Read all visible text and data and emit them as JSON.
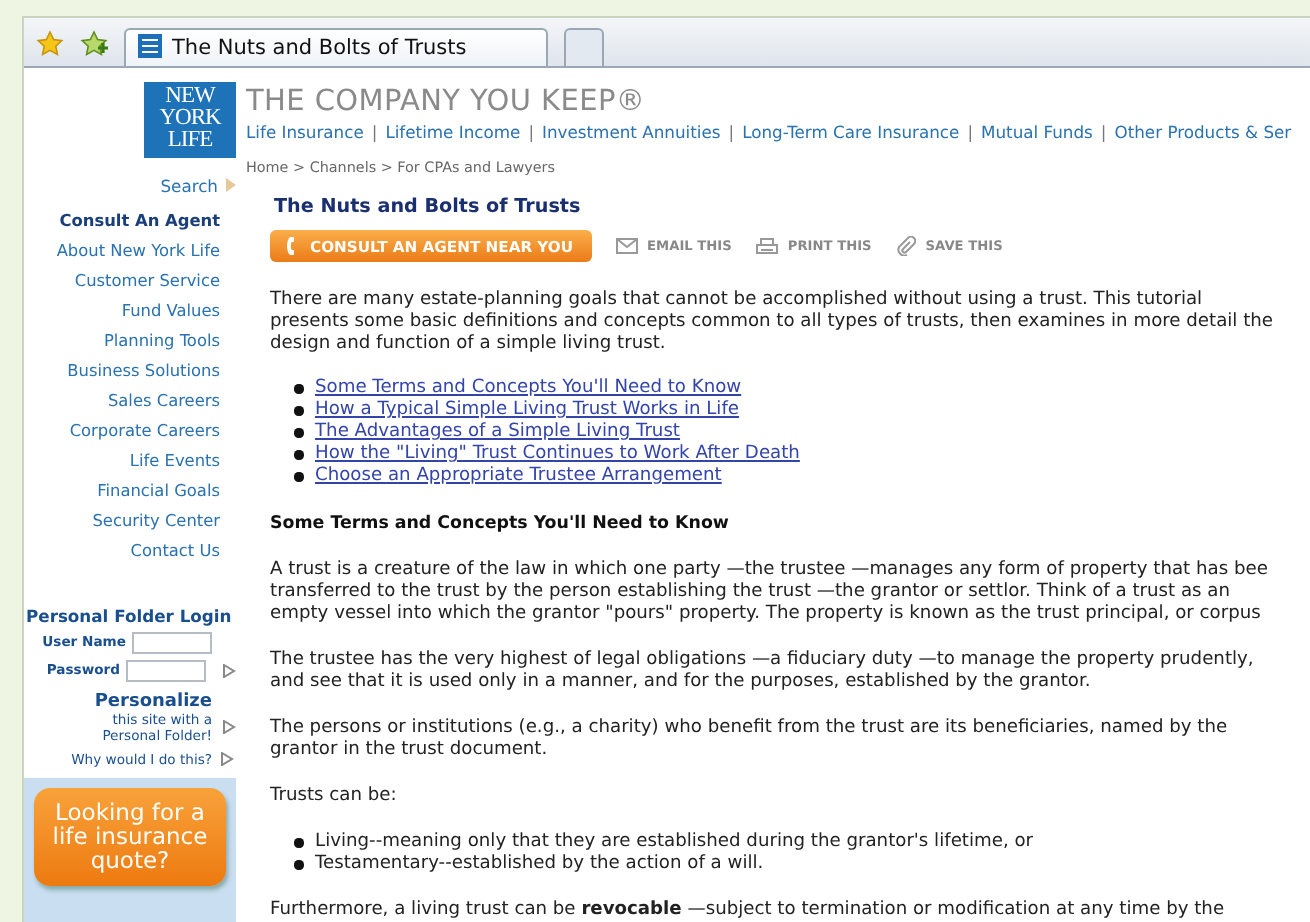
{
  "browser": {
    "tabs": [
      {
        "label": "The Nuts and Bolts of Trusts",
        "selected": true
      },
      {
        "selected": false
      }
    ]
  },
  "header": {
    "logo": [
      "NEW",
      "YORK",
      "LIFE"
    ],
    "tagline": "THE COMPANY YOU KEEP®",
    "nav_separator": "|",
    "nav": [
      "Life Insurance",
      "Lifetime Income",
      "Investment Annuities",
      "Long-Term Care Insurance",
      "Mutual Funds",
      "Other Products & Ser"
    ],
    "breadcrumb": "Home > Channels > For CPAs and Lawyers"
  },
  "sidebar": {
    "search": "Search",
    "items": [
      {
        "label": "Consult An Agent",
        "kind": "primary"
      },
      {
        "label": "About New York Life",
        "kind": "link"
      },
      {
        "label": "Customer Service",
        "kind": "link"
      },
      {
        "label": "Fund Values",
        "kind": "link"
      },
      {
        "label": "Planning Tools",
        "kind": "link"
      },
      {
        "label": "Business Solutions",
        "kind": "link"
      },
      {
        "label": "Sales Careers",
        "kind": "link"
      },
      {
        "label": "Corporate Careers",
        "kind": "link"
      },
      {
        "label": "Life Events",
        "kind": "link"
      },
      {
        "label": "Financial Goals",
        "kind": "link"
      },
      {
        "label": "Security Center",
        "kind": "link"
      },
      {
        "label": "Contact Us",
        "kind": "link"
      }
    ],
    "login": {
      "title": "Personal Folder Login",
      "fields": [
        {
          "label": "User Name"
        },
        {
          "label": "Password"
        }
      ],
      "personalize": {
        "title": "Personalize",
        "text": [
          "this site with a",
          "Personal Folder!"
        ]
      },
      "why": "Why would I do this?"
    },
    "ad": "Looking for a life insurance quote?"
  },
  "article": {
    "title": "The Nuts and Bolts of Trusts",
    "cta": "CONSULT AN AGENT NEAR YOU",
    "actions": [
      {
        "label": "EMAIL THIS",
        "kind": "email"
      },
      {
        "label": "PRINT THIS",
        "kind": "print"
      },
      {
        "label": "SAVE THIS",
        "kind": "save"
      }
    ],
    "blocks": [
      {
        "kind": "paragraph",
        "lines": [
          "There are many estate-planning goals that cannot be accomplished without using a trust. This tutorial",
          "presents some basic definitions and concepts common to all types of trusts, then examines in more detail the",
          "design and function of a simple living trust."
        ]
      },
      {
        "kind": "links",
        "items": [
          "Some Terms and Concepts You'll Need to Know",
          "How a Typical Simple Living Trust Works in Life",
          "The Advantages of a Simple Living Trust",
          "How the \"Living\" Trust Continues to Work After Death",
          "Choose an Appropriate Trustee Arrangement"
        ]
      },
      {
        "kind": "heading",
        "text": "Some Terms and Concepts You'll Need to Know"
      },
      {
        "kind": "paragraph",
        "lines": [
          "A trust is a creature of the law in which one party —the trustee —manages any form of property that has bee",
          "transferred to the trust by the person establishing the trust —the grantor or settlor. Think of a trust as an",
          "empty vessel into which the grantor \"pours\" property. The property is known as the trust principal, or corpus"
        ]
      },
      {
        "kind": "paragraph",
        "lines": [
          "The trustee has the very highest of legal obligations —a fiduciary duty —to manage the property prudently,",
          "and see that it is used only in a manner, and for the purposes, established by the grantor."
        ]
      },
      {
        "kind": "paragraph",
        "lines": [
          "The persons or institutions (e.g., a charity) who benefit from the trust are its beneficiaries, named by the",
          "grantor in the trust document."
        ]
      },
      {
        "kind": "paragraph",
        "lines": [
          "Trusts can be:"
        ]
      },
      {
        "kind": "bullets",
        "items": [
          "Living--meaning only that they are established during the grantor's lifetime, or",
          "Testamentary--established by the action of a will."
        ]
      },
      {
        "kind": "paragraph",
        "lines": [
          "Furthermore, a living trust can be **revocable** —subject to termination or modification at any time by the"
        ]
      }
    ]
  }
}
